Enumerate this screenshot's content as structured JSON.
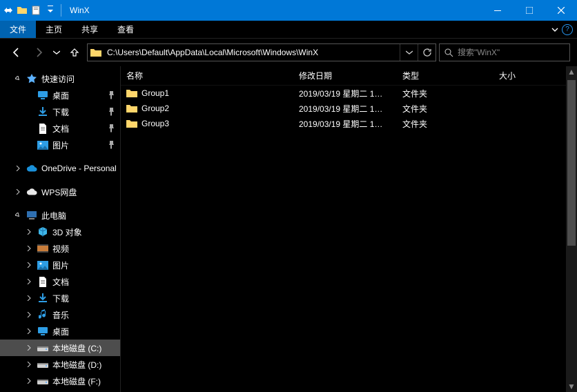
{
  "window": {
    "title": "WinX"
  },
  "ribbon": {
    "file": "文件",
    "tabs": [
      "主页",
      "共享",
      "查看"
    ]
  },
  "address": {
    "path": "C:\\Users\\Default\\AppData\\Local\\Microsoft\\Windows\\WinX"
  },
  "search": {
    "placeholder": "搜索\"WinX\""
  },
  "columns": {
    "name": "名称",
    "date": "修改日期",
    "type": "类型",
    "size": "大小"
  },
  "files": [
    {
      "name": "Group1",
      "date": "2019/03/19 星期二 1…",
      "type": "文件夹",
      "size": ""
    },
    {
      "name": "Group2",
      "date": "2019/03/19 星期二 1…",
      "type": "文件夹",
      "size": ""
    },
    {
      "name": "Group3",
      "date": "2019/03/19 星期二 1…",
      "type": "文件夹",
      "size": ""
    }
  ],
  "sidebar": {
    "quick": {
      "label": "快速访问",
      "items": [
        {
          "label": "桌面",
          "icon": "desktop",
          "pinned": true
        },
        {
          "label": "下载",
          "icon": "download",
          "pinned": true
        },
        {
          "label": "文档",
          "icon": "doc",
          "pinned": true
        },
        {
          "label": "图片",
          "icon": "pic",
          "pinned": true
        }
      ]
    },
    "onedrive": {
      "label": "OneDrive - Personal"
    },
    "wps": {
      "label": "WPS网盘"
    },
    "thispc": {
      "label": "此电脑",
      "items": [
        {
          "label": "3D 对象",
          "icon": "3d"
        },
        {
          "label": "视频",
          "icon": "video"
        },
        {
          "label": "图片",
          "icon": "pic"
        },
        {
          "label": "文档",
          "icon": "doc"
        },
        {
          "label": "下载",
          "icon": "download"
        },
        {
          "label": "音乐",
          "icon": "music"
        },
        {
          "label": "桌面",
          "icon": "desktop"
        },
        {
          "label": "本地磁盘 (C:)",
          "icon": "drive",
          "active": true
        },
        {
          "label": "本地磁盘 (D:)",
          "icon": "drive"
        },
        {
          "label": "本地磁盘 (F:)",
          "icon": "drive"
        }
      ]
    }
  }
}
